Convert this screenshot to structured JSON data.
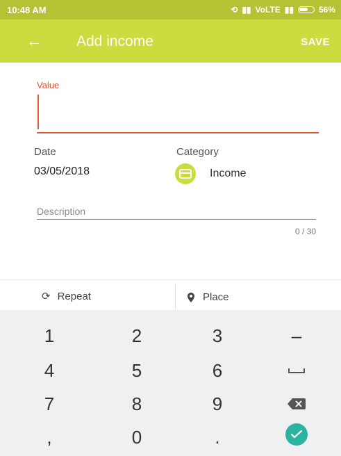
{
  "status": {
    "time": "10:48 AM",
    "network": "VoLTE",
    "battery": "56%"
  },
  "appbar": {
    "title": "Add income",
    "save_label": "SAVE"
  },
  "form": {
    "value_label": "Value",
    "value": "",
    "date_label": "Date",
    "date_value": "03/05/2018",
    "category_label": "Category",
    "category_value": "Income",
    "description_placeholder": "Description",
    "char_counter": "0 / 30"
  },
  "bottombar": {
    "repeat_label": "Repeat",
    "place_label": "Place"
  },
  "keypad": {
    "keys": [
      "1",
      "2",
      "3",
      "4",
      "5",
      "6",
      "7",
      "8",
      "9",
      ",",
      "0",
      "."
    ],
    "minus": "–"
  },
  "colors": {
    "accent": "#cbdc3e",
    "statusbar": "#b3c334",
    "error": "#e8552b",
    "done": "#2bb3a2"
  }
}
